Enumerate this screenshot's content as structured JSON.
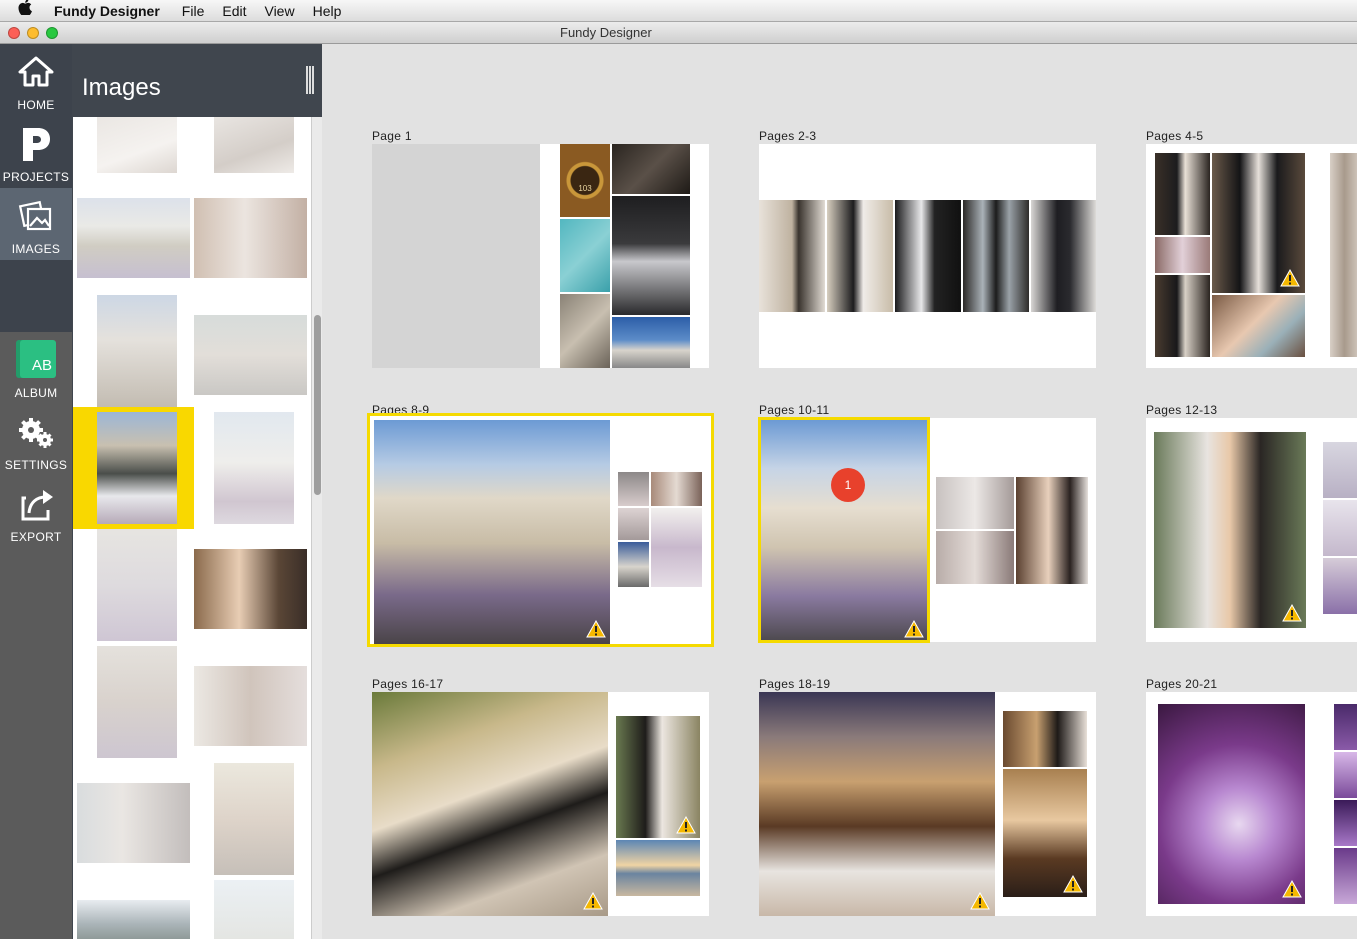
{
  "menubar": {
    "app_name": "Fundy Designer",
    "items": [
      "File",
      "Edit",
      "View",
      "Help"
    ]
  },
  "window": {
    "title": "Fundy Designer"
  },
  "nav": {
    "items": [
      {
        "label": "HOME",
        "icon": "home-icon"
      },
      {
        "label": "PROJECTS",
        "icon": "projects-icon"
      },
      {
        "label": "IMAGES",
        "icon": "images-icon",
        "active": true
      },
      {
        "label": "ALBUM",
        "icon": "album-icon"
      },
      {
        "label": "SETTINGS",
        "icon": "settings-icon"
      },
      {
        "label": "EXPORT",
        "icon": "export-icon"
      }
    ],
    "album_icon_text": "AB"
  },
  "panel": {
    "title": "Images"
  },
  "spreads": [
    {
      "label": "Page 1"
    },
    {
      "label": "Pages 2-3"
    },
    {
      "label": "Pages 4-5"
    },
    {
      "label": "Pages 8-9",
      "selected": true
    },
    {
      "label": "Pages 10-11",
      "badge": "1"
    },
    {
      "label": "Pages 12-13"
    },
    {
      "label": "Pages 16-17"
    },
    {
      "label": "Pages 18-19"
    },
    {
      "label": "Pages 20-21"
    }
  ],
  "photo_tiles": {
    "room_number": "103"
  },
  "colors": {
    "selection": "#f5da00",
    "nav_active": "#5c6672",
    "album_green": "#2bbf82",
    "badge_red": "#e8412c",
    "warning": "#f5b800"
  }
}
